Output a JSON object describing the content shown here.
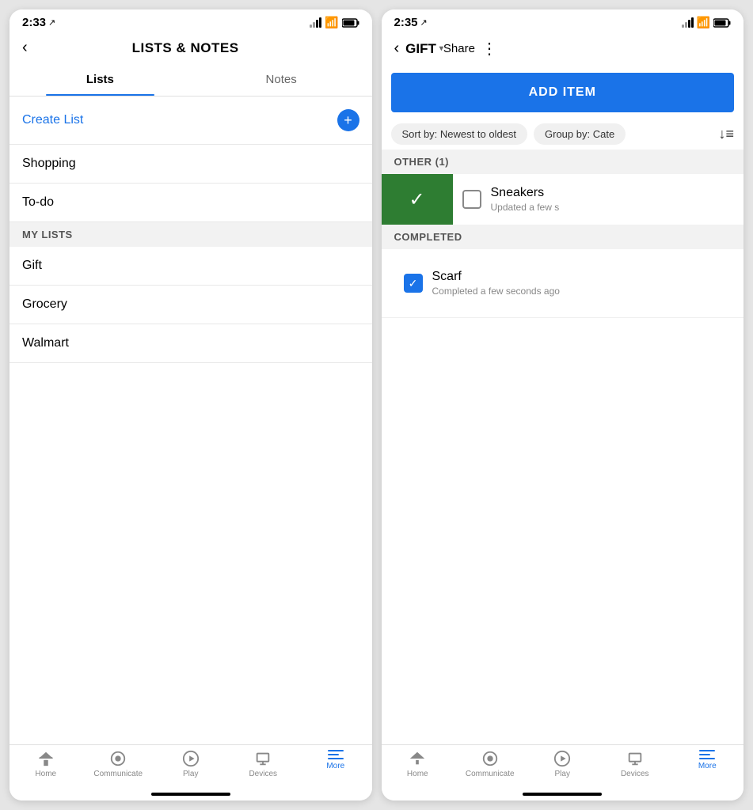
{
  "left_screen": {
    "status_bar": {
      "time": "2:33",
      "location_icon": "◂",
      "signal": "▂▄",
      "wifi": "wifi",
      "battery": "battery"
    },
    "nav": {
      "back_label": "<",
      "title": "LISTS & NOTES"
    },
    "tabs": [
      {
        "label": "Lists",
        "active": true
      },
      {
        "label": "Notes",
        "active": false
      }
    ],
    "create_list": {
      "label": "Create List",
      "plus": "+"
    },
    "list_items": [
      {
        "name": "Shopping"
      },
      {
        "name": "To-do"
      }
    ],
    "my_lists_section": {
      "header": "MY LISTS",
      "items": [
        {
          "name": "Gift"
        },
        {
          "name": "Grocery"
        },
        {
          "name": "Walmart"
        }
      ]
    },
    "bottom_tabs": [
      {
        "label": "Home",
        "icon": "home",
        "active": false
      },
      {
        "label": "Communicate",
        "icon": "communicate",
        "active": false
      },
      {
        "label": "Play",
        "icon": "play",
        "active": false
      },
      {
        "label": "Devices",
        "icon": "devices",
        "active": false
      },
      {
        "label": "More",
        "icon": "more",
        "active": true
      }
    ]
  },
  "right_screen": {
    "status_bar": {
      "time": "2:35",
      "location_icon": "◂"
    },
    "nav": {
      "back_label": "<",
      "title": "GIFT",
      "dropdown_arrow": "▾",
      "share_label": "Share",
      "dots": "⋮"
    },
    "add_item_btn": "ADD ITEM",
    "filter_chips": [
      {
        "label": "Sort by: Newest to oldest"
      },
      {
        "label": "Group by: Cate"
      }
    ],
    "sort_icon": "↓≡",
    "other_section": {
      "header": "OTHER (1)",
      "items": [
        {
          "name": "Sneakers",
          "meta": "Updated a few s",
          "swiped": true,
          "checked": false
        }
      ]
    },
    "completed_section": {
      "header": "COMPLETED",
      "items": [
        {
          "name": "Scarf",
          "meta": "Completed a few seconds ago",
          "checked": true
        }
      ]
    },
    "bottom_tabs": [
      {
        "label": "Home",
        "icon": "home",
        "active": false
      },
      {
        "label": "Communicate",
        "icon": "communicate",
        "active": false
      },
      {
        "label": "Play",
        "icon": "play",
        "active": false
      },
      {
        "label": "Devices",
        "icon": "devices",
        "active": false
      },
      {
        "label": "More",
        "icon": "more",
        "active": true
      }
    ]
  }
}
